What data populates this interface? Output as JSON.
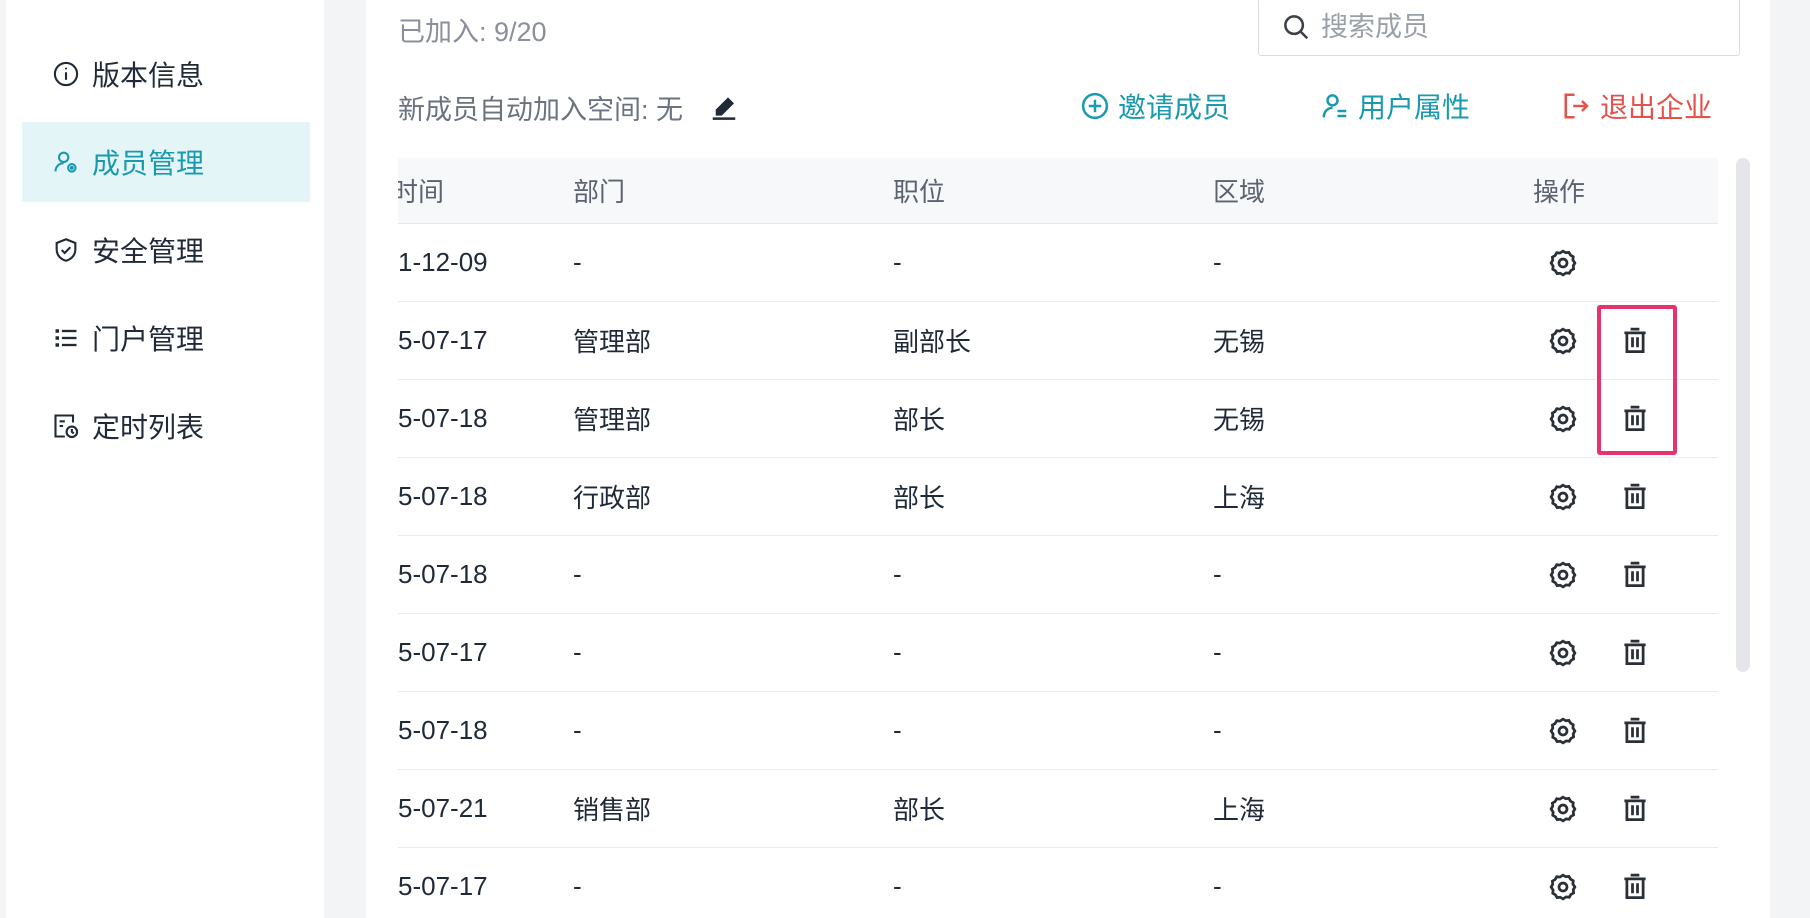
{
  "sidebar": {
    "items": [
      {
        "label": "版本信息",
        "icon": "info-icon",
        "active": false
      },
      {
        "label": "成员管理",
        "icon": "member-settings-icon",
        "active": true
      },
      {
        "label": "安全管理",
        "icon": "shield-check-icon",
        "active": false
      },
      {
        "label": "门户管理",
        "icon": "list-icon",
        "active": false
      },
      {
        "label": "定时列表",
        "icon": "scheduled-list-icon",
        "active": false
      }
    ]
  },
  "header": {
    "joined_text": "已加入: 9/20",
    "search_placeholder": "搜索成员",
    "auto_join_text": "新成员自动加入空间: 无",
    "invite_label": "邀请成员",
    "attributes_label": "用户属性",
    "exit_label": "退出企业"
  },
  "table": {
    "columns": [
      "时间",
      "部门",
      "职位",
      "区域",
      "操作"
    ],
    "rows": [
      {
        "time": "1-12-09",
        "dept": "-",
        "position": "-",
        "area": "-",
        "deletable": false
      },
      {
        "time": "5-07-17",
        "dept": "管理部",
        "position": "副部长",
        "area": "无锡",
        "deletable": true
      },
      {
        "time": "5-07-18",
        "dept": "管理部",
        "position": "部长",
        "area": "无锡",
        "deletable": true
      },
      {
        "time": "5-07-18",
        "dept": "行政部",
        "position": "部长",
        "area": "上海",
        "deletable": true
      },
      {
        "time": "5-07-18",
        "dept": "-",
        "position": "-",
        "area": "-",
        "deletable": true
      },
      {
        "time": "5-07-17",
        "dept": "-",
        "position": "-",
        "area": "-",
        "deletable": true
      },
      {
        "time": "5-07-18",
        "dept": "-",
        "position": "-",
        "area": "-",
        "deletable": true
      },
      {
        "time": "5-07-21",
        "dept": "销售部",
        "position": "部长",
        "area": "上海",
        "deletable": true
      },
      {
        "time": "5-07-17",
        "dept": "-",
        "position": "-",
        "area": "-",
        "deletable": true
      }
    ]
  },
  "colors": {
    "accent": "#1a9aae",
    "danger": "#e3524b",
    "highlight": "#e4336d",
    "active_bg": "#e4f5f8"
  }
}
